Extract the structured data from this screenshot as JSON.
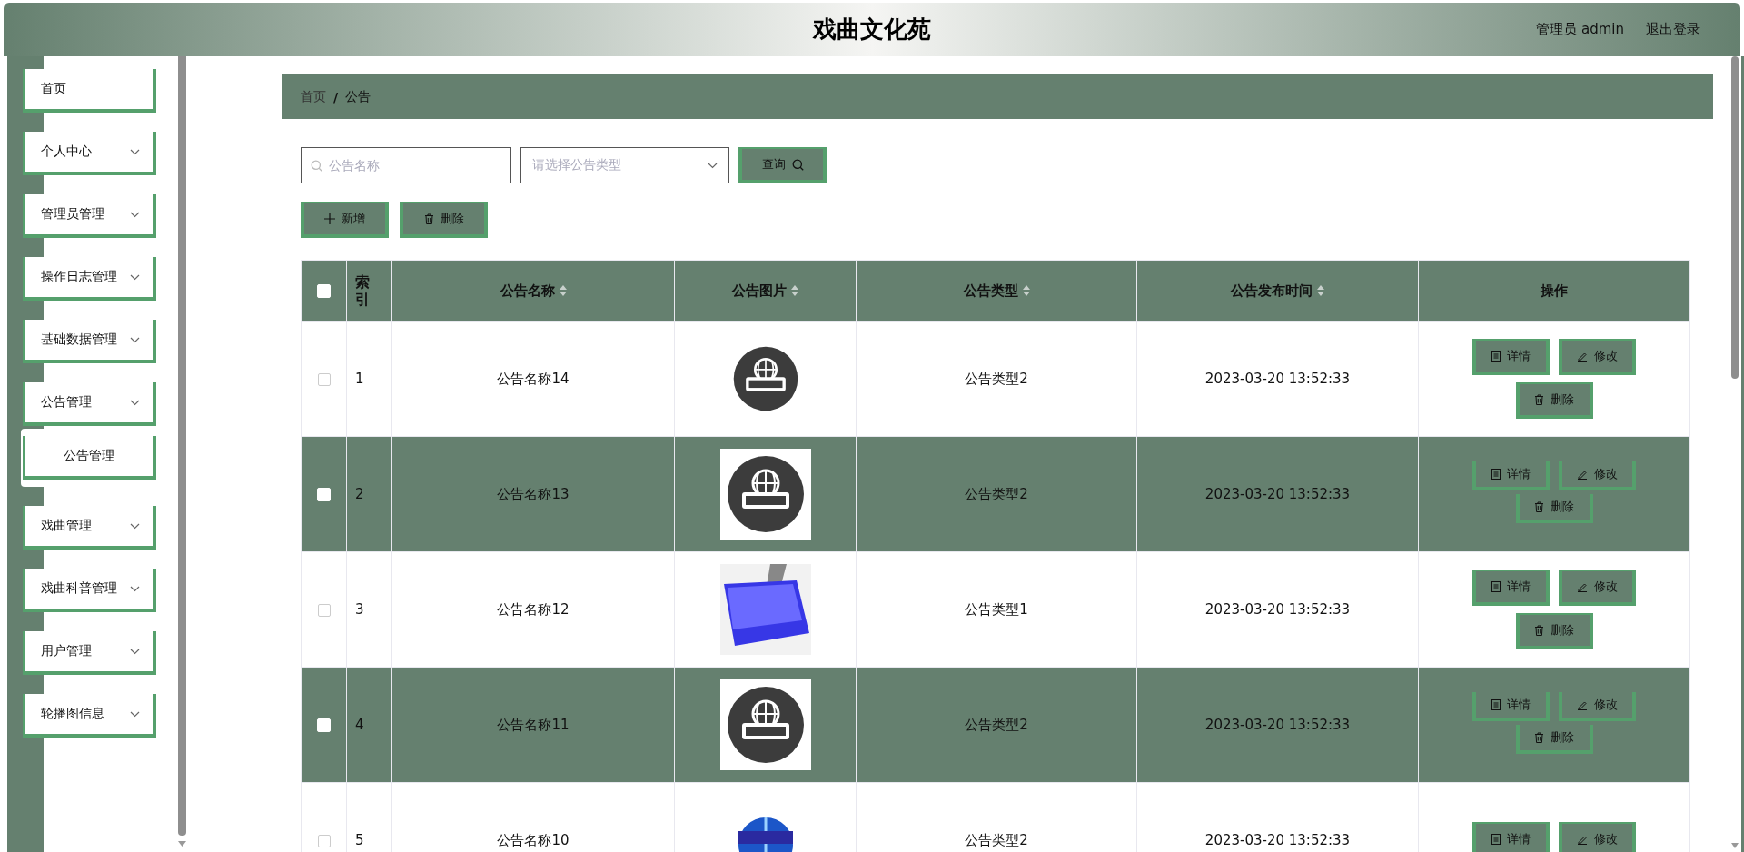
{
  "header": {
    "title": "戏曲文化苑",
    "user": "管理员 admin",
    "logout": "退出登录"
  },
  "sidebar": {
    "items": [
      {
        "label": "首页",
        "kind": "link"
      },
      {
        "label": "个人中心",
        "kind": "menu"
      },
      {
        "label": "管理员管理",
        "kind": "menu"
      },
      {
        "label": "操作日志管理",
        "kind": "menu"
      },
      {
        "label": "基础数据管理",
        "kind": "menu"
      },
      {
        "label": "公告管理",
        "kind": "menu",
        "children": [
          {
            "label": "公告管理"
          }
        ]
      },
      {
        "label": "戏曲管理",
        "kind": "menu"
      },
      {
        "label": "戏曲科普管理",
        "kind": "menu"
      },
      {
        "label": "用户管理",
        "kind": "menu"
      },
      {
        "label": "轮播图信息",
        "kind": "menu"
      }
    ]
  },
  "breadcrumb": {
    "separator": "/",
    "items": [
      "首页",
      "公告"
    ]
  },
  "search": {
    "name_placeholder": "公告名称",
    "type_placeholder": "请选择公告类型",
    "query_button": "查询"
  },
  "actions": [
    {
      "kind": "add",
      "label": "新增"
    },
    {
      "kind": "delete",
      "label": "删除"
    }
  ],
  "table": {
    "select_all_checked": false,
    "columns": [
      {
        "label": "索引",
        "sortable": false
      },
      {
        "label": "公告名称",
        "sortable": true
      },
      {
        "label": "公告图片",
        "sortable": true
      },
      {
        "label": "公告类型",
        "sortable": true
      },
      {
        "label": "公告发布时间",
        "sortable": true
      },
      {
        "label": "操作",
        "sortable": false
      }
    ],
    "rows": [
      {
        "checked": false,
        "index": "1",
        "name": "公告名称14",
        "image": {
          "kind": "badge"
        },
        "type": "公告类型2",
        "time": "2023-03-20 13:52:33",
        "buttons": [
          {
            "kind": "detail",
            "label": "详情"
          },
          {
            "kind": "edit",
            "label": "修改"
          },
          {
            "kind": "delete",
            "label": "删除"
          }
        ]
      },
      {
        "checked": false,
        "index": "2",
        "name": "公告名称13",
        "image": {
          "kind": "badge"
        },
        "type": "公告类型2",
        "time": "2023-03-20 13:52:33",
        "buttons": [
          {
            "kind": "detail",
            "label": "详情"
          },
          {
            "kind": "edit",
            "label": "修改"
          },
          {
            "kind": "delete",
            "label": "删除"
          }
        ]
      },
      {
        "checked": false,
        "index": "3",
        "name": "公告名称12",
        "image": {
          "kind": "key"
        },
        "type": "公告类型1",
        "time": "2023-03-20 13:52:33",
        "buttons": [
          {
            "kind": "detail",
            "label": "详情"
          },
          {
            "kind": "edit",
            "label": "修改"
          },
          {
            "kind": "delete",
            "label": "删除"
          }
        ]
      },
      {
        "checked": false,
        "index": "4",
        "name": "公告名称11",
        "image": {
          "kind": "badge"
        },
        "type": "公告类型2",
        "time": "2023-03-20 13:52:33",
        "buttons": [
          {
            "kind": "detail",
            "label": "详情"
          },
          {
            "kind": "edit",
            "label": "修改"
          },
          {
            "kind": "delete",
            "label": "删除"
          }
        ]
      },
      {
        "checked": false,
        "index": "5",
        "name": "公告名称10",
        "image": {
          "kind": "globe"
        },
        "type": "公告类型2",
        "time": "2023-03-20 13:52:33",
        "buttons": [
          {
            "kind": "detail",
            "label": "详情"
          },
          {
            "kind": "edit",
            "label": "修改"
          }
        ]
      }
    ]
  }
}
